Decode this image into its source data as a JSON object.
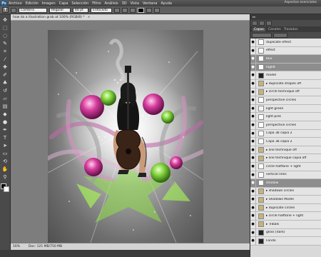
{
  "app": {
    "logo": "Ps",
    "workspace": "Aspectos esenciales"
  },
  "menu": [
    "Archivo",
    "Edición",
    "Imagen",
    "Capa",
    "Selección",
    "Filtro",
    "Análisis",
    "3D",
    "Vista",
    "Ventana",
    "Ayuda"
  ],
  "options": {
    "font_family": "Cambria",
    "font_style": "Regular",
    "font_size": "60 pt",
    "antialias": "Enfocado"
  },
  "document": {
    "tab_title": "how do a illustration grab at 100% (RGB/8) *",
    "zoom": "16%",
    "doc_info": "Doc: 121 MB/750 MB"
  },
  "layers_panel": {
    "tabs": [
      "Capas",
      "Canales",
      "Trazados"
    ],
    "layers": [
      {
        "name": "duplicate effect",
        "selected": false,
        "group": false,
        "thumb": "white"
      },
      {
        "name": "effect",
        "selected": false,
        "group": false,
        "thumb": "white"
      },
      {
        "name": "blur",
        "selected": true,
        "group": false,
        "thumb": "white"
      },
      {
        "name": "highlt",
        "selected": true,
        "group": false,
        "thumb": "white"
      },
      {
        "name": "model",
        "selected": false,
        "group": false,
        "thumb": "dark"
      },
      {
        "name": "duplicate shapes off",
        "selected": false,
        "group": true,
        "thumb": "none"
      },
      {
        "name": "circle technique off",
        "selected": false,
        "group": true,
        "thumb": "none"
      },
      {
        "name": "perspective circles",
        "selected": false,
        "group": false,
        "thumb": "white"
      },
      {
        "name": "light green",
        "selected": false,
        "group": false,
        "thumb": "mask"
      },
      {
        "name": "light pink",
        "selected": false,
        "group": false,
        "thumb": "white"
      },
      {
        "name": "perspective circles",
        "selected": false,
        "group": false,
        "thumb": "white"
      },
      {
        "name": "Capa 3b copia 2",
        "selected": false,
        "group": false,
        "thumb": "white"
      },
      {
        "name": "Capa 3b copia 2",
        "selected": false,
        "group": false,
        "thumb": "white"
      },
      {
        "name": "line technique off",
        "selected": false,
        "group": true,
        "thumb": "none"
      },
      {
        "name": "line technique copia off",
        "selected": false,
        "group": true,
        "thumb": "none"
      },
      {
        "name": "circle halftone + light",
        "selected": false,
        "group": false,
        "thumb": "white"
      },
      {
        "name": "vertical lines",
        "selected": false,
        "group": false,
        "thumb": "white"
      },
      {
        "name": "shadow",
        "selected": true,
        "group": false,
        "thumb": "white"
      },
      {
        "name": "shadows circles",
        "selected": false,
        "group": true,
        "thumb": "none"
      },
      {
        "name": "Shadows Model",
        "selected": false,
        "group": true,
        "thumb": "none"
      },
      {
        "name": "duplicate circles",
        "selected": false,
        "group": true,
        "thumb": "none"
      },
      {
        "name": "circle halftone + light",
        "selected": false,
        "group": true,
        "thumb": "none"
      },
      {
        "name": "Tribals",
        "selected": false,
        "group": true,
        "thumb": "none"
      },
      {
        "name": "gloss (dark)",
        "selected": false,
        "group": false,
        "thumb": "dark"
      },
      {
        "name": "Fondo",
        "selected": false,
        "group": false,
        "thumb": "dark"
      }
    ]
  },
  "colors": {
    "canvas_glow": "#f0f0f0",
    "pink": "#d63c9c",
    "green": "#7fd23a",
    "selected_row": "#8d8d8d"
  }
}
